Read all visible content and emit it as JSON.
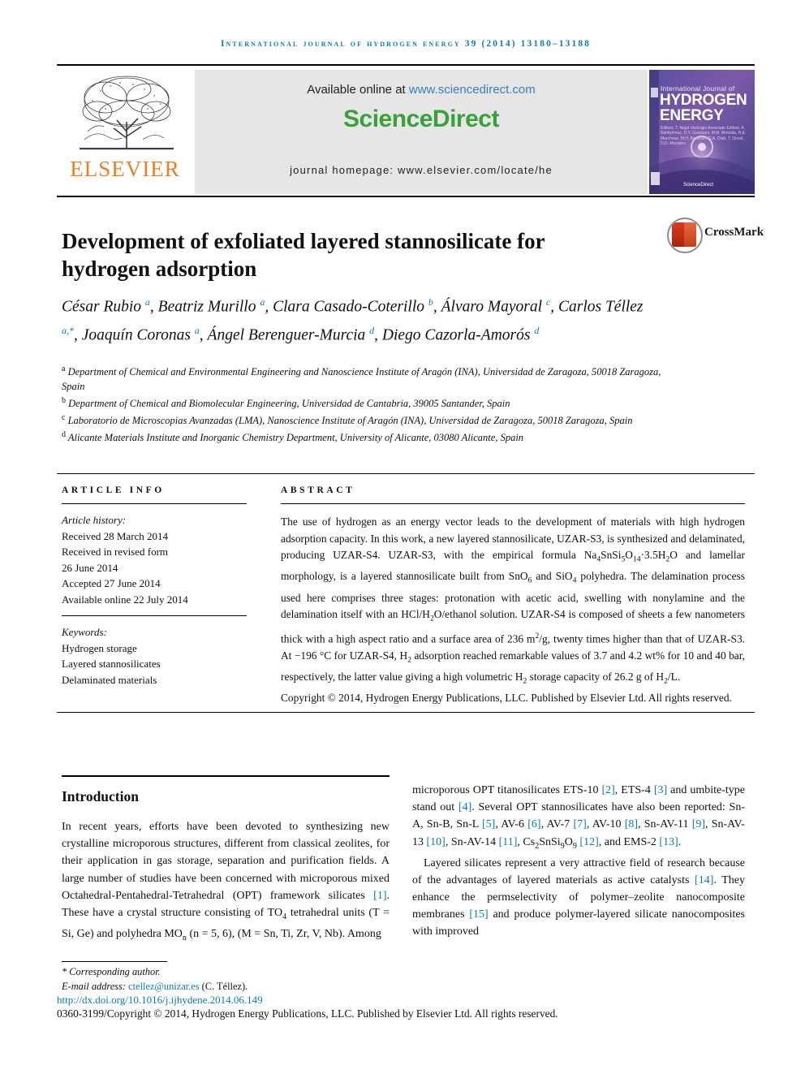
{
  "running_head": "International Journal of Hydrogen Energy 39 (2014) 13180–13188",
  "masthead": {
    "elsevier_wordmark": "ELSEVIER",
    "available_prefix": "Available online at ",
    "available_url": "www.sciencedirect.com",
    "sciencedirect_logo": "ScienceDirect",
    "journal_homepage": "journal homepage: www.elsevier.com/locate/he",
    "cover": {
      "title_small": "International Journal of",
      "title_big": "HYDROGEN ENERGY",
      "editors": "Editors:  T. Nejat Veziroglu\nAssociate Editors:  A. Bahtiyılmaz, D.Y. Goswami, M.M. Almeida,\nR.E. Marchese, M.H. Bardhan,\nG.A. Olah, T. Oncel, D.D. Muradov",
      "sciencedirect": "ScienceDirect"
    }
  },
  "crossmark": {
    "label": "CrossMark"
  },
  "title": "Development of exfoliated layered stannosilicate for hydrogen adsorption",
  "authors_html": "César Rubio <sup>a</sup>, Beatriz Murillo <sup>a</sup>, Clara Casado-Coterillo <sup>b</sup>, Álvaro Mayoral <sup>c</sup>, Carlos Téllez <sup>a,*</sup>, Joaquín Coronas <sup>a</sup>, Ángel Berenguer-Murcia <sup>d</sup>, Diego Cazorla-Amorós <sup>d</sup>",
  "affiliations": [
    {
      "marker": "a",
      "text": "Department of Chemical and Environmental Engineering and Nanoscience Institute of Aragón (INA), Universidad de Zaragoza, 50018 Zaragoza, Spain"
    },
    {
      "marker": "b",
      "text": "Department of Chemical and Biomolecular Engineering, Universidad de Cantabria, 39005 Santander, Spain"
    },
    {
      "marker": "c",
      "text": "Laboratorio de Microscopias Avanzadas (LMA), Nanoscience Institute of Aragón (INA), Universidad de Zaragoza, 50018 Zaragoza, Spain"
    },
    {
      "marker": "d",
      "text": "Alicante Materials Institute and Inorganic Chemistry Department, University of Alicante, 03080 Alicante, Spain"
    }
  ],
  "article_info": {
    "heading": "ARTICLE INFO",
    "history_label": "Article history:",
    "history": [
      "Received 28 March 2014",
      "Received in revised form",
      "26 June 2014",
      "Accepted 27 June 2014",
      "Available online 22 July 2014"
    ],
    "keywords_label": "Keywords:",
    "keywords": [
      "Hydrogen storage",
      "Layered stannosilicates",
      "Delaminated materials"
    ]
  },
  "abstract": {
    "heading": "ABSTRACT",
    "body_html": "The use of hydrogen as an energy vector leads to the development of materials with high hydrogen adsorption capacity. In this work, a new layered stannosilicate, UZAR-S3, is synthesized and delaminated, producing UZAR-S4. UZAR-S3, with the empirical formula Na<sub>4</sub>SnSi<sub>5</sub>O<sub>14</sub>·3.5H<sub>2</sub>O and lamellar morphology, is a layered stannosilicate built from SnO<sub>6</sub> and SiO<sub>4</sub> polyhedra. The delamination process used here comprises three stages: protonation with acetic acid, swelling with nonylamine and the delamination itself with an HCl/H<sub>2</sub>O/ethanol solution. UZAR-S4 is composed of sheets a few nanometers thick with a high aspect ratio and a surface area of 236 m<sup class=\"num\">2</sup>/g, twenty times higher than that of UZAR-S3. At −196 °C for UZAR-S4, H<sub>2</sub> adsorption reached remarkable values of 3.7 and 4.2 wt% for 10 and 40 bar, respectively, the latter value giving a high volumetric H<sub>2</sub> storage capacity of 26.2 g of H<sub>2</sub>/L.",
    "copyright_html": "Copyright © 2014, Hydrogen Energy Publications, LLC. Published by Elsevier Ltd. All rights reserved."
  },
  "introduction": {
    "heading": "Introduction",
    "left_html": "<p>In recent years, efforts have been devoted to synthesizing new crystalline microporous structures, different from classical zeolites, for their application in gas storage, separation and purification fields. A large number of studies have been concerned with microporous mixed Octahedral-Pentahedral-Tetrahedral (OPT) framework silicates <span class=\"ref\">[1]</span>. These have a crystal structure consisting of TO<sub>4</sub> tetrahedral units (T = Si, Ge) and polyhedra MO<sub>n</sub> (n = 5, 6), (M = Sn, Ti, Zr, V, Nb). Among</p>",
    "right_html": "<p>microporous OPT titanosilicates ETS-10 <span class=\"ref\">[2]</span>, ETS-4 <span class=\"ref\">[3]</span> and umbite-type stand out <span class=\"ref\">[4]</span>. Several OPT stannosilicates have also been reported: Sn-A, Sn-B, Sn-L <span class=\"ref\">[5]</span>, AV-6 <span class=\"ref\">[6]</span>, AV-7 <span class=\"ref\">[7]</span>, AV-10 <span class=\"ref\">[8]</span>, Sn-AV-11 <span class=\"ref\">[9]</span>, Sn-AV-13 <span class=\"ref\">[10]</span>, Sn-AV-14 <span class=\"ref\">[11]</span>, Cs<sub>2</sub>SnSi<sub>9</sub>O<sub>9</sub> <span class=\"ref\">[12]</span>, and EMS-2 <span class=\"ref\">[13]</span>.</p><p>Layered silicates represent a very attractive field of research because of the advantages of layered materials as active catalysts <span class=\"ref\">[14]</span>. They enhance the permselectivity of polymer–zeolite nanocomposite membranes <span class=\"ref\">[15]</span> and produce polymer-layered silicate nanocomposites with improved</p>"
  },
  "footer": {
    "corresponding_author": "* Corresponding author.",
    "email_label": "E-mail address: ",
    "email": "ctellez@unizar.es",
    "email_suffix": " (C. Téllez).",
    "doi": "http://dx.doi.org/10.1016/j.ijhydene.2014.06.149",
    "issn_line": "0360-3199/Copyright © 2014, Hydrogen Energy Publications, LLC. Published by Elsevier Ltd. All rights reserved."
  },
  "colors": {
    "journal_blue": "#0b7ab5",
    "elsevier_orange": "#f07d23",
    "sciencedirect_green": "#3aa03a",
    "link_blue": "#3a7fc1",
    "crossmark_red": "#d93b1e"
  }
}
